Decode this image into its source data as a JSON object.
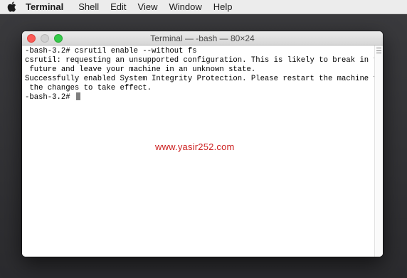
{
  "menubar": {
    "app_name": "Terminal",
    "items": [
      "Shell",
      "Edit",
      "View",
      "Window",
      "Help"
    ]
  },
  "window": {
    "title": "Terminal — -bash — 80×24"
  },
  "terminal": {
    "lines": [
      "-bash-3.2# csrutil enable --without fs",
      "csrutil: requesting an unsupported configuration. This is likely to break in the",
      " future and leave your machine in an unknown state.",
      "Successfully enabled System Integrity Protection. Please restart the machine for",
      " the changes to take effect.",
      "-bash-3.2# "
    ]
  },
  "watermark": "www.yasir252.com",
  "colors": {
    "close": "#fc5b57",
    "minimize": "#d1d1d1",
    "zoom": "#35cb4b",
    "watermark": "#cc1f1f"
  }
}
